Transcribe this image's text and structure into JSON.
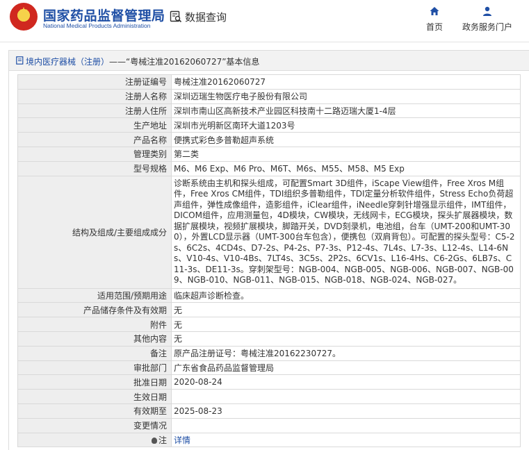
{
  "header": {
    "brand_cn": "国家药品监督管理局",
    "brand_en": "National Medical Products Administration",
    "query_label": "数据查询",
    "nav": [
      {
        "label": "首页",
        "icon": "home-icon"
      },
      {
        "label": "政务服务门户",
        "icon": "user-icon"
      }
    ]
  },
  "panel": {
    "title_prefix": "境内医疗器械（注册）",
    "title_suffix": "——“粤械注准20162060727”基本信息"
  },
  "fields": [
    {
      "label": "注册证编号",
      "value": "粤械注准20162060727"
    },
    {
      "label": "注册人名称",
      "value": "深圳迈瑞生物医疗电子股份有限公司"
    },
    {
      "label": "注册人住所",
      "value": "深圳市南山区高新技术产业园区科技南十二路迈瑞大厦1-4层"
    },
    {
      "label": "生产地址",
      "value": "深圳市光明新区南环大道1203号"
    },
    {
      "label": "产品名称",
      "value": "便携式彩色多普勒超声系统"
    },
    {
      "label": "管理类别",
      "value": "第二类"
    },
    {
      "label": "型号规格",
      "value": "M6、M6 Exp、M6 Pro、M6T、M6s、M55、M58、M5 Exp"
    },
    {
      "label": "结构及组成/主要组成成分",
      "value": "诊断系统由主机和探头组成，可配置Smart 3D组件，iScape View组件，Free Xros M组件，Free Xros CM组件，TDI组织多普勒组件，TDI定量分析软件组件，Stress Echo负荷超声组件，弹性成像组件，造影组件，iClear组件，iNeedle穿刺针增强显示组件，IMT组件，DICOM组件，应用测量包，4D模块，CW模块，无线网卡，ECG模块，探头扩展器模块，数据扩展模块，视频扩展模块，脚踏开关，DVD刻录机，电池组，台车（UMT-200和UMT-300），外置LCD显示器（UMT-300台车包含），便携包（双肩背包）。可配置的探头型号：C5-2s、6C2s、4CD4s、D7-2s、P4-2s、P7-3s、P12-4s、7L4s、L7-3s、L12-4s、L14-6Ns、V10-4s、V10-4Bs、7LT4s、3C5s、2P2s、6CV1s、L16-4Hs、C6-2Gs、6LB7s、C11-3s、DE11-3s。穿刺架型号：NGB-004、NGB-005、NGB-006、NGB-007、NGB-009、NGB-010、NGB-011、NGB-015、NGB-018、NGB-024、NGB-027。"
    },
    {
      "label": "适用范围/预期用途",
      "value": "临床超声诊断检查。"
    },
    {
      "label": "产品储存条件及有效期",
      "value": "无"
    },
    {
      "label": "附件",
      "value": "无"
    },
    {
      "label": "其他内容",
      "value": "无"
    },
    {
      "label": "备注",
      "value": "原产品注册证号：粤械注准20162230727。"
    },
    {
      "label": "审批部门",
      "value": "广东省食品药品监督管理局"
    },
    {
      "label": "批准日期",
      "value": "2020-08-24"
    },
    {
      "label": "生效日期",
      "value": ""
    },
    {
      "label": "有效期至",
      "value": "2025-08-23"
    },
    {
      "label": "变更情况",
      "value": ""
    }
  ],
  "note": {
    "label": "注",
    "link_text": "详情"
  }
}
